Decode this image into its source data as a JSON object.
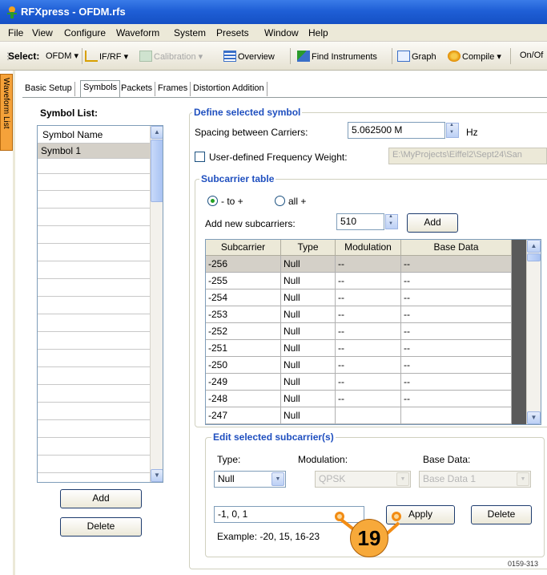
{
  "window": {
    "title": "RFXpress - OFDM.rfs"
  },
  "menu": [
    "File",
    "View",
    "Configure",
    "Waveform",
    "System",
    "Presets",
    "Window",
    "Help"
  ],
  "toolbar": {
    "select_label": "Select:",
    "select_value": "OFDM",
    "if_rf": "IF/RF",
    "calibration": "Calibration",
    "overview": "Overview",
    "find_instruments": "Find Instruments",
    "graph": "Graph",
    "compile": "Compile",
    "onoff": "On/Of"
  },
  "side_tab": "Waveform List",
  "tabs": [
    "Basic Setup",
    "Symbols",
    "Packets",
    "Frames",
    "Distortion Addition"
  ],
  "active_tab": "Symbols",
  "symbol_list": {
    "label": "Symbol List:",
    "header": "Symbol Name",
    "rows": [
      "Symbol 1"
    ],
    "add": "Add",
    "delete": "Delete"
  },
  "define": {
    "title": "Define selected symbol",
    "spacing_label": "Spacing between Carriers:",
    "spacing_value": "5.062500 M",
    "spacing_unit": "Hz",
    "weight_label": "User-defined Frequency Weight:",
    "weight_path": "E:\\MyProjects\\Eiffel2\\Sept24\\San"
  },
  "subcarrier": {
    "title": "Subcarrier table",
    "radio_to": "- to +",
    "radio_all": "all +",
    "add_label": "Add new subcarriers:",
    "add_count": "510",
    "add_button": "Add",
    "columns": [
      "Subcarrier",
      "Type",
      "Modulation",
      "Base Data"
    ],
    "rows": [
      [
        "-256",
        "Null",
        "--",
        "--"
      ],
      [
        "-255",
        "Null",
        "--",
        "--"
      ],
      [
        "-254",
        "Null",
        "--",
        "--"
      ],
      [
        "-253",
        "Null",
        "--",
        "--"
      ],
      [
        "-252",
        "Null",
        "--",
        "--"
      ],
      [
        "-251",
        "Null",
        "--",
        "--"
      ],
      [
        "-250",
        "Null",
        "--",
        "--"
      ],
      [
        "-249",
        "Null",
        "--",
        "--"
      ],
      [
        "-248",
        "Null",
        "--",
        "--"
      ],
      [
        "-247",
        "Null",
        "",
        ""
      ]
    ]
  },
  "edit": {
    "title": "Edit selected subcarrier(s)",
    "type_label": "Type:",
    "type_value": "Null",
    "modulation_label": "Modulation:",
    "modulation_value": "QPSK",
    "base_label": "Base Data:",
    "base_value": "Base Data 1",
    "input_value": "-1, 0, 1",
    "apply": "Apply",
    "delete": "Delete",
    "example": "Example: -20, 15, 16-23"
  },
  "callout": "19",
  "figure_id": "0159-313",
  "colors": {
    "titlebar": "#1f5fd6",
    "group_title": "#1f4fbf",
    "callout": "#f28c14",
    "side_tab": "#f5a23a"
  }
}
